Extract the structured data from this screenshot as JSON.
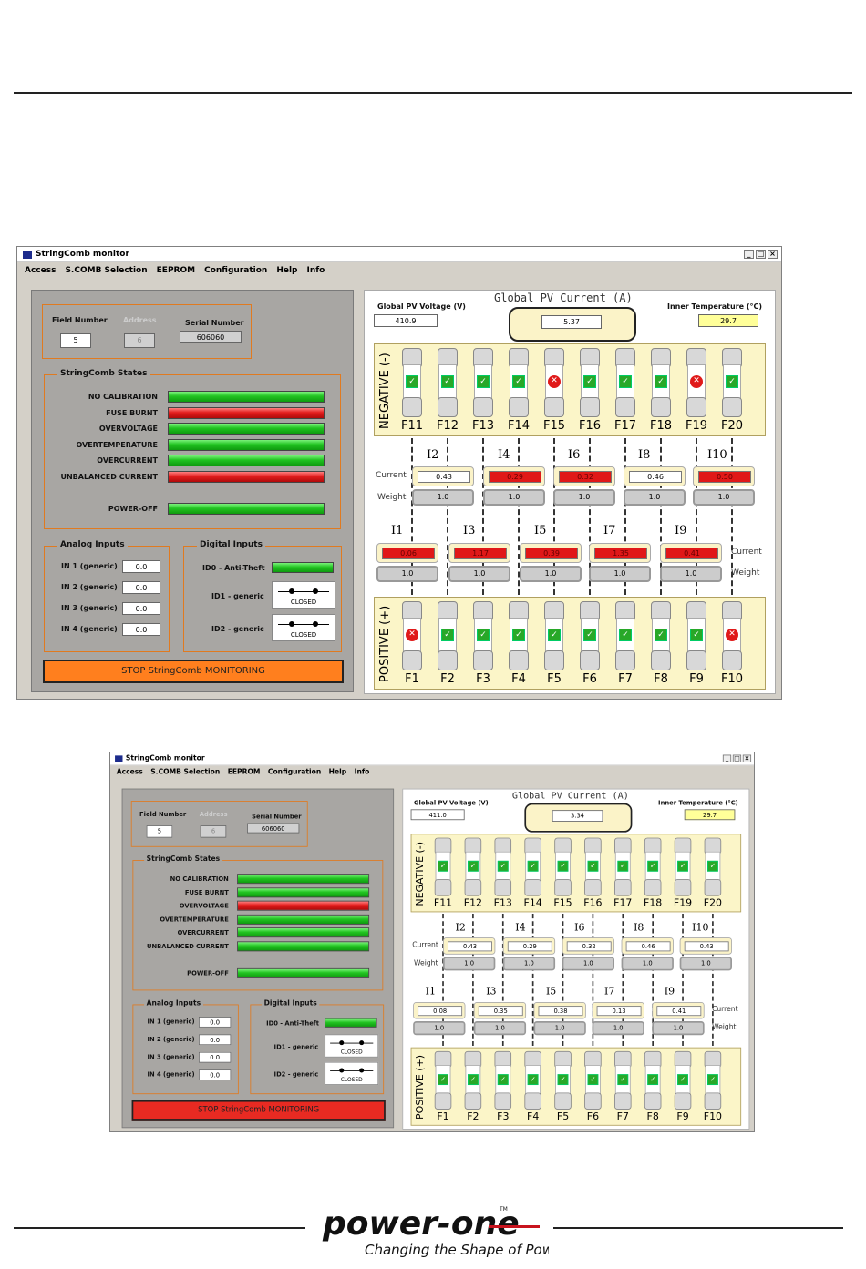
{
  "page": {
    "logo_word": "power-one",
    "logo_tm": "TM",
    "logo_tagline": "Changing the Shape of Power"
  },
  "screens": [
    {
      "title": "StringComb monitor",
      "menu": [
        "Access",
        "S.COMB Selection",
        "EEPROM",
        "Configuration",
        "Help",
        "Info"
      ],
      "field_label": "Field Number",
      "field_value": "5",
      "address_label": "Address",
      "address_value": "6",
      "serial_label": "Serial Number",
      "serial_value": "606060",
      "states_title": "StringComb States",
      "states": [
        {
          "label": "NO CALIBRATION",
          "status": "green"
        },
        {
          "label": "FUSE BURNT",
          "status": "red"
        },
        {
          "label": "OVERVOLTAGE",
          "status": "green"
        },
        {
          "label": "OVERTEMPERATURE",
          "status": "green"
        },
        {
          "label": "OVERCURRENT",
          "status": "green"
        },
        {
          "label": "UNBALANCED CURRENT",
          "status": "red"
        }
      ],
      "poweroff_label": "POWER-OFF",
      "analog_title": "Analog Inputs",
      "analog": [
        {
          "label": "IN 1 (generic)",
          "value": "0.0"
        },
        {
          "label": "IN 2 (generic)",
          "value": "0.0"
        },
        {
          "label": "IN 3 (generic)",
          "value": "0.0"
        },
        {
          "label": "IN 4 (generic)",
          "value": "0.0"
        }
      ],
      "digital_title": "Digital Inputs",
      "id0_label": "ID0 - Anti-Theft",
      "id1_label": "ID1 - generic",
      "id1_state": "CLOSED",
      "id2_label": "ID2 - generic",
      "id2_state": "CLOSED",
      "stop_label": "STOP StringComb MONITORING",
      "stop_color": "#ff7f1e",
      "voltage_label": "Global PV Voltage (V)",
      "voltage_value": "410.9",
      "current_title": "Global PV Current (A)",
      "current_value": "5.37",
      "temp_label": "Inner Temperature (°C)",
      "temp_value": "29.7",
      "negative_label": "NEGATIVE (-)",
      "positive_label": "POSITIVE (+)",
      "neg_fuses": [
        {
          "label": "F11",
          "ok": true
        },
        {
          "label": "F12",
          "ok": true
        },
        {
          "label": "F13",
          "ok": true
        },
        {
          "label": "F14",
          "ok": true
        },
        {
          "label": "F15",
          "ok": false
        },
        {
          "label": "F16",
          "ok": true
        },
        {
          "label": "F17",
          "ok": true
        },
        {
          "label": "F18",
          "ok": true
        },
        {
          "label": "F19",
          "ok": false
        },
        {
          "label": "F20",
          "ok": true
        }
      ],
      "pos_fuses": [
        {
          "label": "F1",
          "ok": false
        },
        {
          "label": "F2",
          "ok": true
        },
        {
          "label": "F3",
          "ok": true
        },
        {
          "label": "F4",
          "ok": true
        },
        {
          "label": "F5",
          "ok": true
        },
        {
          "label": "F6",
          "ok": true
        },
        {
          "label": "F7",
          "ok": true
        },
        {
          "label": "F8",
          "ok": true
        },
        {
          "label": "F9",
          "ok": true
        },
        {
          "label": "F10",
          "ok": false
        }
      ],
      "upper_strings": [
        {
          "label": "I2",
          "current": "0.43",
          "alarm": false,
          "weight": "1.0"
        },
        {
          "label": "I4",
          "current": "0.29",
          "alarm": true,
          "weight": "1.0"
        },
        {
          "label": "I6",
          "current": "0.32",
          "alarm": true,
          "weight": "1.0"
        },
        {
          "label": "I8",
          "current": "0.46",
          "alarm": false,
          "weight": "1.0"
        },
        {
          "label": "I10",
          "current": "0.50",
          "alarm": true,
          "weight": "1.0"
        }
      ],
      "lower_strings": [
        {
          "label": "I1",
          "current": "0.06",
          "alarm": true,
          "weight": "1.0"
        },
        {
          "label": "I3",
          "current": "1.17",
          "alarm": true,
          "weight": "1.0"
        },
        {
          "label": "I5",
          "current": "0.39",
          "alarm": true,
          "weight": "1.0"
        },
        {
          "label": "I7",
          "current": "1.35",
          "alarm": true,
          "weight": "1.0"
        },
        {
          "label": "I9",
          "current": "0.41",
          "alarm": true,
          "weight": "1.0"
        }
      ],
      "row_current_label": "Current",
      "row_weight_label": "Weight"
    },
    {
      "title": "StringComb monitor",
      "menu": [
        "Access",
        "S.COMB Selection",
        "EEPROM",
        "Configuration",
        "Help",
        "Info"
      ],
      "field_label": "Field Number",
      "field_value": "5",
      "address_label": "Address",
      "address_value": "6",
      "serial_label": "Serial Number",
      "serial_value": "606060",
      "states_title": "StringComb States",
      "states": [
        {
          "label": "NO CALIBRATION",
          "status": "green"
        },
        {
          "label": "FUSE BURNT",
          "status": "green"
        },
        {
          "label": "OVERVOLTAGE",
          "status": "red"
        },
        {
          "label": "OVERTEMPERATURE",
          "status": "green"
        },
        {
          "label": "OVERCURRENT",
          "status": "green"
        },
        {
          "label": "UNBALANCED CURRENT",
          "status": "green"
        }
      ],
      "poweroff_label": "POWER-OFF",
      "analog_title": "Analog Inputs",
      "analog": [
        {
          "label": "IN 1 (generic)",
          "value": "0.0"
        },
        {
          "label": "IN 2 (generic)",
          "value": "0.0"
        },
        {
          "label": "IN 3 (generic)",
          "value": "0.0"
        },
        {
          "label": "IN 4 (generic)",
          "value": "0.0"
        }
      ],
      "digital_title": "Digital Inputs",
      "id0_label": "ID0 - Anti-Theft",
      "id1_label": "ID1 - generic",
      "id1_state": "CLOSED",
      "id2_label": "ID2 - generic",
      "id2_state": "CLOSED",
      "stop_label": "STOP StringComb MONITORING",
      "stop_color": "#e82a22",
      "voltage_label": "Global PV Voltage (V)",
      "voltage_value": "411.0",
      "current_title": "Global PV Current (A)",
      "current_value": "3.34",
      "temp_label": "Inner Temperature (°C)",
      "temp_value": "29.7",
      "negative_label": "NEGATIVE (-)",
      "positive_label": "POSITIVE (+)",
      "neg_fuses": [
        {
          "label": "F11",
          "ok": true
        },
        {
          "label": "F12",
          "ok": true
        },
        {
          "label": "F13",
          "ok": true
        },
        {
          "label": "F14",
          "ok": true
        },
        {
          "label": "F15",
          "ok": true
        },
        {
          "label": "F16",
          "ok": true
        },
        {
          "label": "F17",
          "ok": true
        },
        {
          "label": "F18",
          "ok": true
        },
        {
          "label": "F19",
          "ok": true
        },
        {
          "label": "F20",
          "ok": true
        }
      ],
      "pos_fuses": [
        {
          "label": "F1",
          "ok": true
        },
        {
          "label": "F2",
          "ok": true
        },
        {
          "label": "F3",
          "ok": true
        },
        {
          "label": "F4",
          "ok": true
        },
        {
          "label": "F5",
          "ok": true
        },
        {
          "label": "F6",
          "ok": true
        },
        {
          "label": "F7",
          "ok": true
        },
        {
          "label": "F8",
          "ok": true
        },
        {
          "label": "F9",
          "ok": true
        },
        {
          "label": "F10",
          "ok": true
        }
      ],
      "upper_strings": [
        {
          "label": "I2",
          "current": "0.43",
          "alarm": false,
          "weight": "1.0"
        },
        {
          "label": "I4",
          "current": "0.29",
          "alarm": false,
          "weight": "1.0"
        },
        {
          "label": "I6",
          "current": "0.32",
          "alarm": false,
          "weight": "1.0"
        },
        {
          "label": "I8",
          "current": "0.46",
          "alarm": false,
          "weight": "1.0"
        },
        {
          "label": "I10",
          "current": "0.43",
          "alarm": false,
          "weight": "1.0"
        }
      ],
      "lower_strings": [
        {
          "label": "I1",
          "current": "0.08",
          "alarm": false,
          "weight": "1.0"
        },
        {
          "label": "I3",
          "current": "0.35",
          "alarm": false,
          "weight": "1.0"
        },
        {
          "label": "I5",
          "current": "0.38",
          "alarm": false,
          "weight": "1.0"
        },
        {
          "label": "I7",
          "current": "0.13",
          "alarm": false,
          "weight": "1.0"
        },
        {
          "label": "I9",
          "current": "0.41",
          "alarm": false,
          "weight": "1.0"
        }
      ],
      "row_current_label": "Current",
      "row_weight_label": "Weight"
    }
  ]
}
